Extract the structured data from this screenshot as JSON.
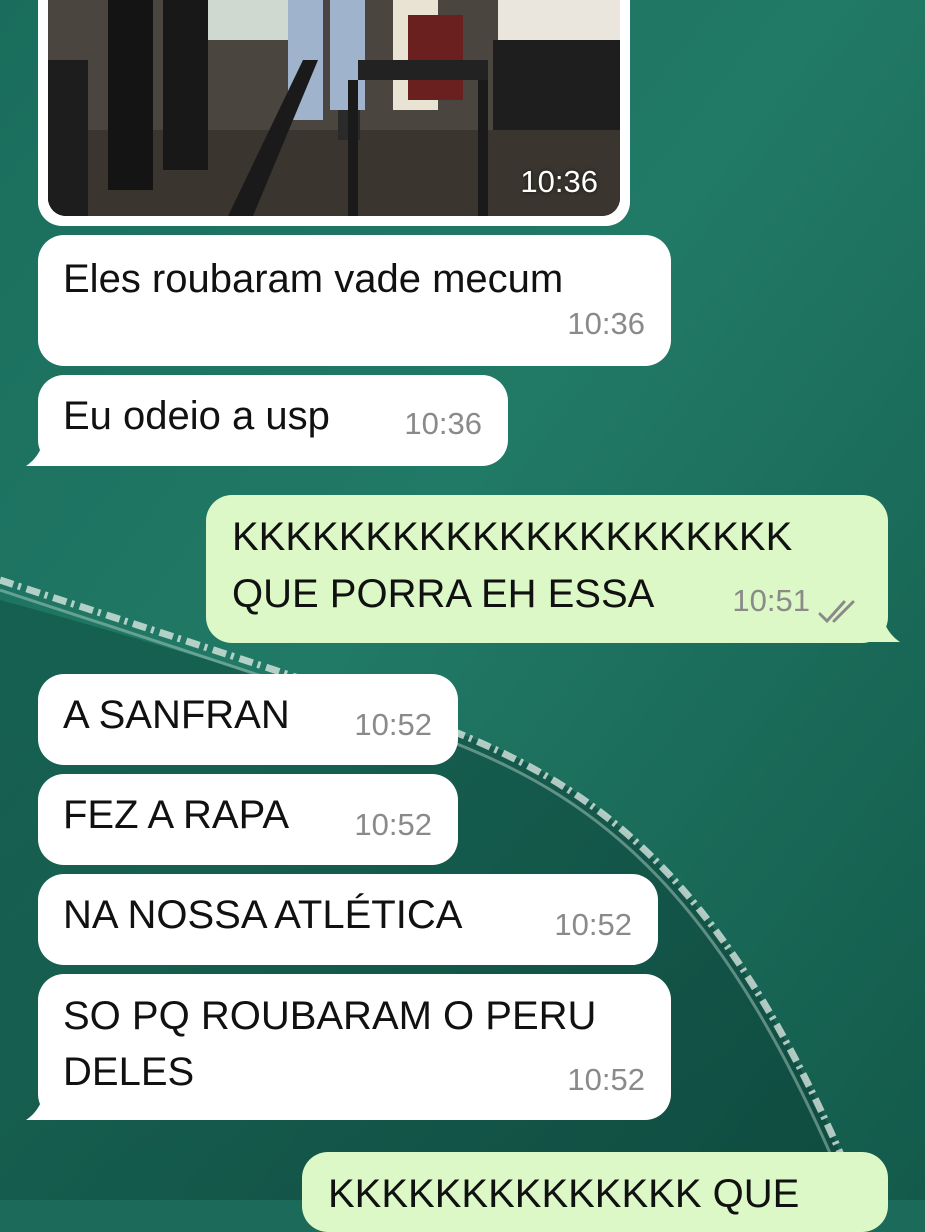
{
  "colors": {
    "incoming_bubble": "#ffffff",
    "outgoing_bubble": "#dcf8c6",
    "timestamp": "#8a8a8a",
    "wallpaper": "#1c6a5a",
    "read_checks": "#8a8a8a"
  },
  "photo_message": {
    "time": "10:36"
  },
  "messages": [
    {
      "direction": "incoming",
      "text": "Eles roubaram vade mecum",
      "time": "10:36"
    },
    {
      "direction": "incoming",
      "text": "Eu odeio a usp",
      "time": "10:36"
    },
    {
      "direction": "outgoing",
      "lines": [
        "KKKKKKKKKKKKKKKKKKKKK",
        "QUE PORRA EH ESSA"
      ],
      "time": "10:51",
      "status_icon": "double-check-icon"
    },
    {
      "direction": "incoming",
      "text": "A SANFRAN",
      "time": "10:52"
    },
    {
      "direction": "incoming",
      "text": "FEZ A RAPA",
      "time": "10:52"
    },
    {
      "direction": "incoming",
      "text": "NA NOSSA ATLÉTICA",
      "time": "10:52"
    },
    {
      "direction": "incoming",
      "lines": [
        "SO PQ ROUBARAM O PERU",
        "DELES"
      ],
      "time": "10:52"
    },
    {
      "direction": "outgoing",
      "text": "KKKKKKKKKKKKKK QUE"
    }
  ]
}
